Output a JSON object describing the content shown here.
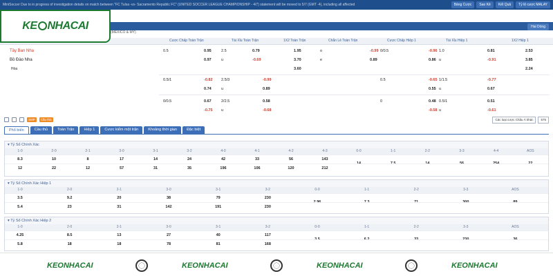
{
  "topbar": {
    "notice": "MiniSoccer Due to in progress of investigation details on match between \"FC Tulsa -vs- Sacramento Republic FC\" (UNITED SOCCER LEAGUE CHAMPIONSHIP - 4/7) statement will be moved to 5/7 (GMT -4), including all affected",
    "buttons": [
      "Bảng Cược",
      "Sao Kê",
      "Kết Quả",
      "Tỷ lệ cược MALAY"
    ]
  },
  "logo": {
    "left": "KE",
    "right": "NHACAI"
  },
  "lang": "Hai Dòng",
  "match": {
    "league": "(MEXICO & MỸ)"
  },
  "odds_headers": [
    "Cược Chấp Toàn Trận",
    "Tài Xỉu Toàn Trận",
    "1X2 Toàn Trận",
    "Chẵn Lẻ Toàn Trận",
    "Cược Chấp Hiệp 1",
    "Tài Xỉu Hiệp 1",
    "1X2 Hiệp 1"
  ],
  "teams": [
    "Tây Ban Nha",
    "Bồ Đào Nha",
    "Hòa"
  ],
  "main_odds": [
    [
      "0.5",
      "0.95",
      "2.5",
      "0.79",
      "1.95",
      "o",
      "-0.99",
      "0/0.5",
      "-0.96",
      "1.0",
      "0.81",
      "2.53"
    ],
    [
      "",
      "0.97",
      "u",
      "-0.69",
      "3.70",
      "e",
      "0.89",
      "",
      "0.86",
      "u",
      "-0.91",
      "3.85"
    ],
    [
      "",
      "",
      "",
      "",
      "3.60",
      "",
      "",
      "",
      "",
      "",
      "",
      "2.24"
    ]
  ],
  "alt_odds": [
    [
      "0.5/1",
      "-0.82",
      "2.5/3",
      "-0.99",
      "0.5",
      "-0.65",
      "1/1.5",
      "-0.77"
    ],
    [
      "",
      "0.74",
      "u",
      "0.89",
      "",
      "0.55",
      "u",
      "0.67"
    ],
    [
      "0/0.5",
      "0.67",
      "2/2.5",
      "0.58",
      "0",
      "0.48",
      "0.5/1",
      "0.51"
    ],
    [
      "",
      "-0.75",
      "u",
      "-0.68",
      "",
      "-0.58",
      "u",
      "-0.61"
    ]
  ],
  "toolbar": {
    "smp": "SMP",
    "live": "Cầu thủ",
    "select1": "Các loại cược Châu Á khác",
    "select2": "575"
  },
  "tabs": [
    "Phổ biến",
    "Cầu thủ",
    "Toàn Trận",
    "Hiệp 1",
    "Cược kiểm một trận",
    "Khoảng thời gian",
    "Đặc biệt"
  ],
  "sections": [
    {
      "title": "Tỷ Số Chính Xác",
      "headers": [
        "1-0",
        "2-0",
        "2-1",
        "3-0",
        "3-1",
        "3-2",
        "4-0",
        "4-1",
        "4-2",
        "4-3",
        "0-0",
        "1-1",
        "2-2",
        "3-3",
        "4-4",
        "AOS"
      ],
      "row1": [
        "8.3",
        "10",
        "8",
        "17",
        "14",
        "24",
        "42",
        "33",
        "56",
        "143"
      ],
      "row2": [
        "12",
        "22",
        "12",
        "57",
        "31",
        "35",
        "196",
        "106",
        "120",
        "212"
      ],
      "draws": [
        "14",
        "7.5",
        "14",
        "56",
        "254",
        "22"
      ]
    },
    {
      "title": "Tỷ Số Chính Xác Hiệp 1",
      "headers": [
        "1-0",
        "2-0",
        "2-1",
        "3-0",
        "3-1",
        "3-2",
        "0-0",
        "1-1",
        "2-2",
        "3-3",
        "AOS"
      ],
      "row1": [
        "3.5",
        "9.2",
        "20",
        "38",
        "79",
        "230"
      ],
      "row2": [
        "5.4",
        "23",
        "31",
        "142",
        "191",
        "230"
      ],
      "draws": [
        "2.96",
        "7.3",
        "71",
        "300",
        "89"
      ]
    },
    {
      "title": "Tỷ Số Chính Xác Hiệp 2",
      "headers": [
        "1-0",
        "2-0",
        "2-1",
        "3-0",
        "3-1",
        "3-2",
        "0-0",
        "1-1",
        "2-2",
        "3-3",
        "AOS"
      ],
      "row1": [
        "4.25",
        "8.5",
        "13",
        "27",
        "40",
        "117"
      ],
      "row2": [
        "5.8",
        "18",
        "18",
        "78",
        "81",
        "168"
      ],
      "draws": [
        "3.5",
        "6.2",
        "33",
        "230",
        "36"
      ]
    }
  ],
  "footer": {
    "brand": "KEONHACAI"
  }
}
